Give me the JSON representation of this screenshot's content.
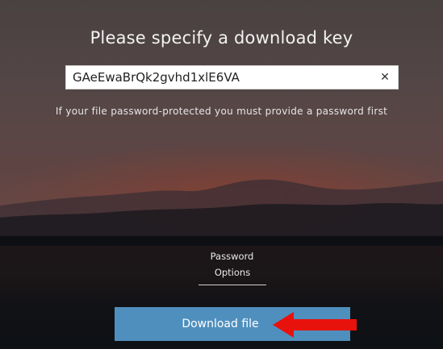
{
  "header": {
    "title": "Please specify a download key"
  },
  "key_input": {
    "value": "GAeEwaBrQk2gvhd1xlE6VA",
    "clear_icon": "close-icon"
  },
  "hint": "If your file password-protected you must provide a password first",
  "password": {
    "label": "Password",
    "options_label": "Options"
  },
  "download_button": {
    "label": "Download file"
  },
  "colors": {
    "button": "#4f8fbe",
    "arrow": "#e8120c",
    "band": "#0e1115"
  }
}
